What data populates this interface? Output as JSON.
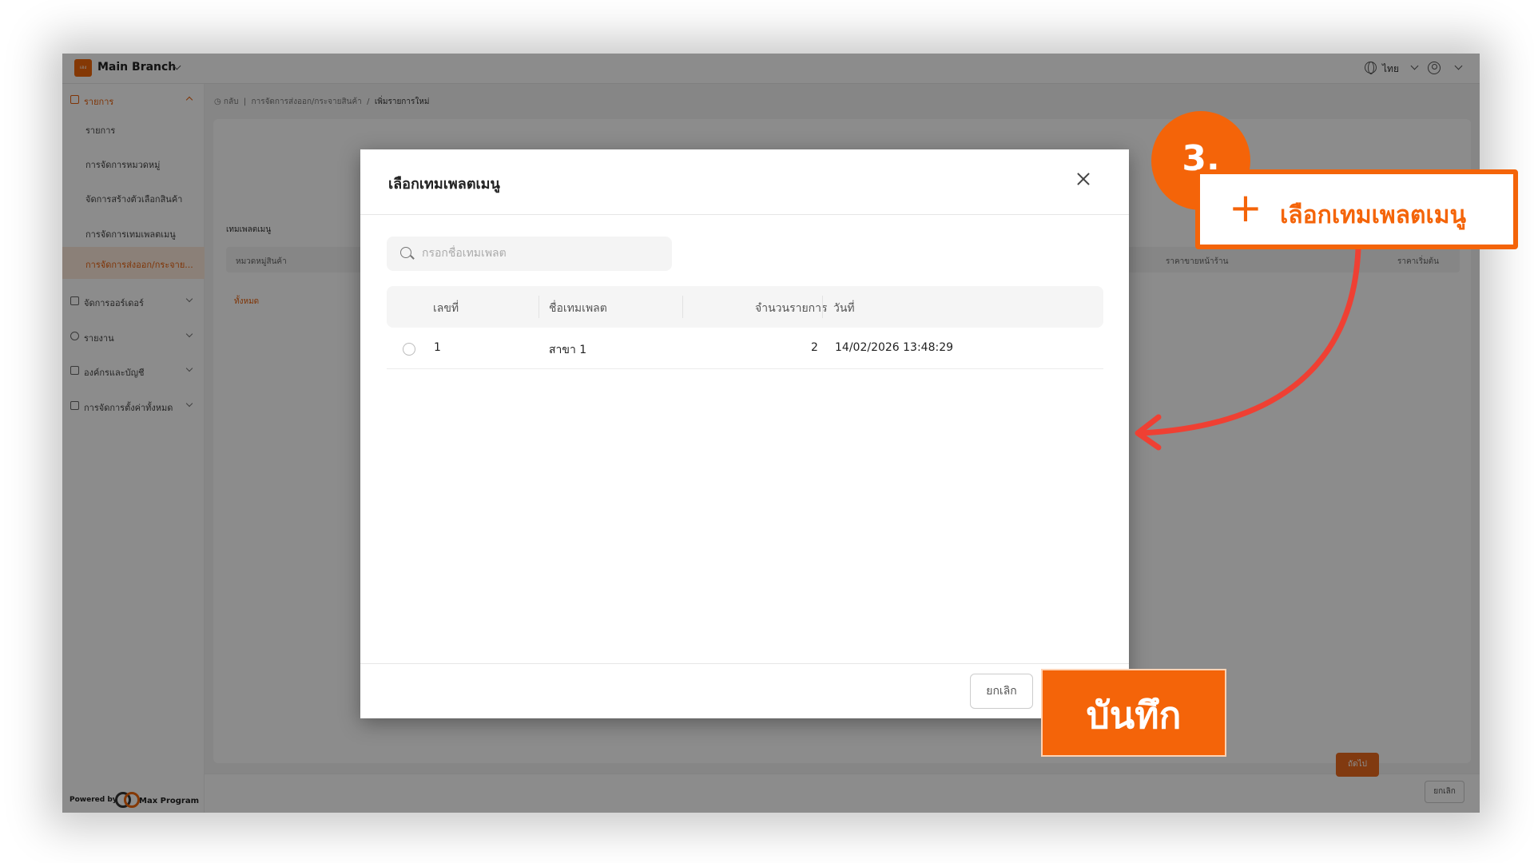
{
  "topbar": {
    "branch": "Main Branch",
    "logo_text": "เฮง",
    "language": "ไทย"
  },
  "breadcrumb": {
    "back": "กลับ",
    "parent": "การจัดการส่งออก/กระจายสินค้า",
    "current": "เพิ่มรายการใหม่"
  },
  "sidebar": {
    "items": [
      {
        "label": "รายการ"
      },
      {
        "label": "รายการ"
      },
      {
        "label": "การจัดการหมวดหมู่"
      },
      {
        "label": "จัดการสร้างตัวเลือกสินค้า"
      },
      {
        "label": "การจัดการเทมเพลตเมนู"
      },
      {
        "label": "การจัดการส่งออก/กระจาย..."
      },
      {
        "label": "จัดการออร์เดอร์"
      },
      {
        "label": "รายงาน"
      },
      {
        "label": "องค์กรและบัญชี"
      },
      {
        "label": "การจัดการตั้งค่าทั้งหมด"
      }
    ],
    "powered": "Powered by",
    "brand": "Max Program"
  },
  "page": {
    "template_label": "เทมเพลตเมนู",
    "columns": [
      "หมวดหมู่สินค้า",
      "ราคาขายหน้าร้าน",
      "ราคาเริ่มต้น"
    ],
    "all_category": "ทั้งหมด",
    "cancel": "ยกเลิก",
    "next": "ถัดไป"
  },
  "modal": {
    "title": "เลือกเทมเพลตเมนู",
    "search_placeholder": "กรอกชื่อเทมเพลต",
    "columns": {
      "no": "เลขที่",
      "name": "ชื่อเทมเพลต",
      "count": "จำนวนรายการ",
      "date": "วันที่"
    },
    "rows": [
      {
        "no": "1",
        "name": "สาขา 1",
        "count": "2",
        "date": "14/02/2026 13:48:29"
      }
    ],
    "cancel": "ยกเลิก"
  },
  "annotations": {
    "step": "3.",
    "callout": "เลือกเทมเพลตเมนู",
    "save": "บันทึก",
    "accent_color": "#f46409"
  }
}
